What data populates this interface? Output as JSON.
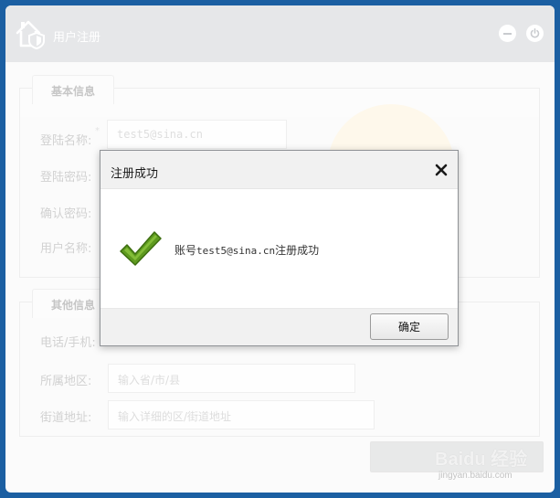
{
  "window": {
    "title": "用户注册",
    "icons": {
      "app": "house-shield-icon",
      "minimize": "minimize-icon",
      "close": "power-icon"
    }
  },
  "form": {
    "basic_section": {
      "tab_label": "基本信息",
      "fields": [
        {
          "label": "登陆名称:",
          "value": "test5@sina.cn"
        },
        {
          "label": "登陆密码:",
          "value": ""
        },
        {
          "label": "确认密码:",
          "value": ""
        },
        {
          "label": "用户名称:",
          "value": ""
        }
      ]
    },
    "other_section": {
      "tab_label": "其他信息",
      "fields": [
        {
          "label": "电话/手机:",
          "placeholder": ""
        },
        {
          "label": "所属地区:",
          "placeholder": "输入省/市/县"
        },
        {
          "label": "街道地址:",
          "placeholder": "输入详细的区/街道地址"
        }
      ]
    },
    "required_mark": "*",
    "submit_label": ""
  },
  "dialog": {
    "title": "注册成功",
    "message_prefix": "账号",
    "message_account": "test5@sina.cn",
    "message_suffix": "注册成功",
    "ok_label": "确定",
    "icons": {
      "close": "close-icon",
      "status": "checkmark-icon"
    },
    "colors": {
      "check": "#5e9a1f"
    }
  },
  "watermark": {
    "main": "Baidu 经验",
    "sub": "jingyan.baidu.com"
  },
  "colors": {
    "frame": "#1b5fa2",
    "titlebar": "#e6e7e9"
  }
}
